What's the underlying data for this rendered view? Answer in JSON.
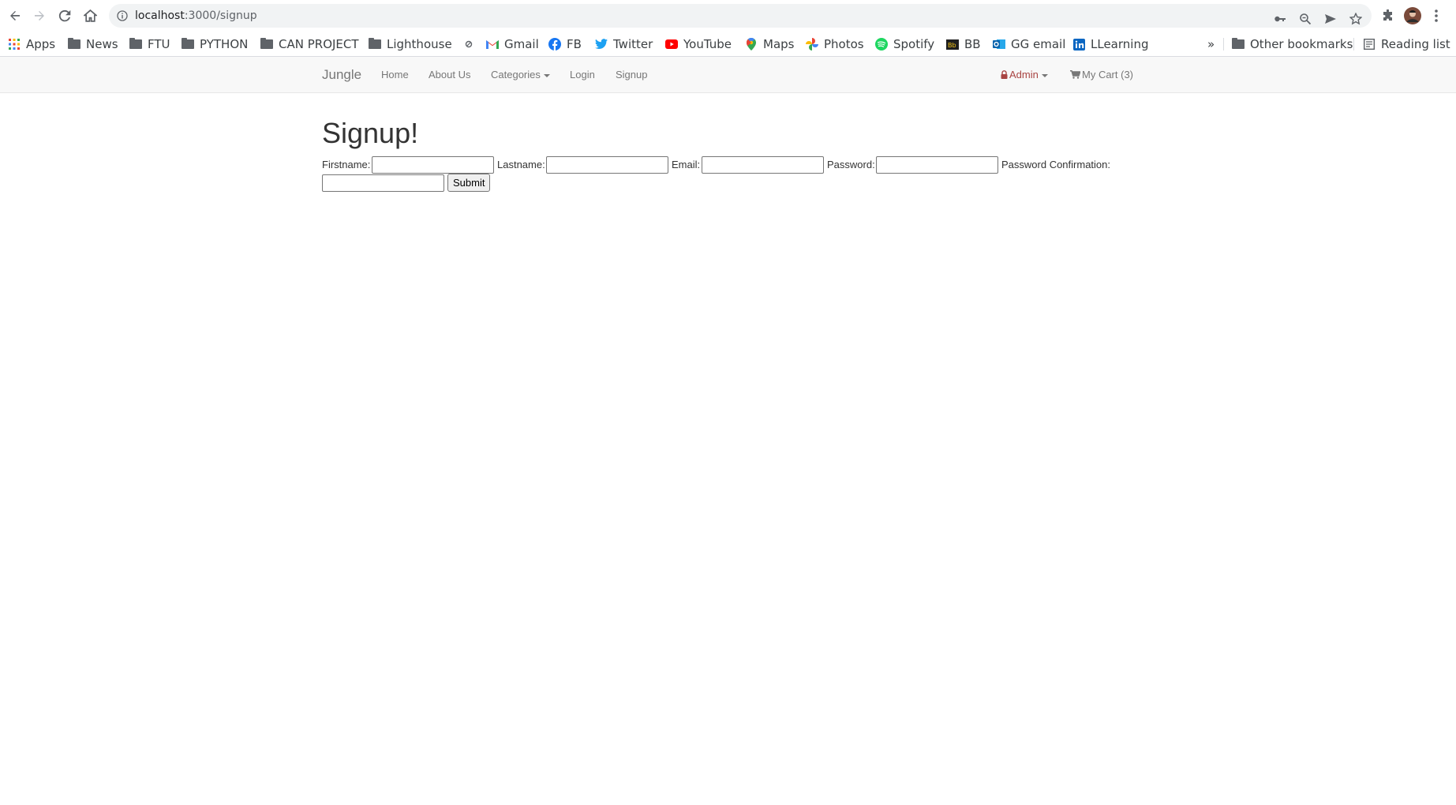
{
  "browser": {
    "url_host": "localhost",
    "url_path": ":3000/signup"
  },
  "bookmarks": [
    {
      "label": "Apps",
      "icon": "apps-grid-icon"
    },
    {
      "label": "News",
      "icon": "folder-icon"
    },
    {
      "label": "FTU",
      "icon": "folder-icon"
    },
    {
      "label": "PYTHON",
      "icon": "folder-icon"
    },
    {
      "label": "CAN PROJECT",
      "icon": "folder-icon"
    },
    {
      "label": "Lighthouse",
      "icon": "folder-icon"
    },
    {
      "label": "",
      "icon": "link-icon"
    },
    {
      "label": "Gmail",
      "icon": "gmail-icon"
    },
    {
      "label": "FB",
      "icon": "facebook-icon"
    },
    {
      "label": "Twitter",
      "icon": "twitter-icon"
    },
    {
      "label": "YouTube",
      "icon": "youtube-icon"
    },
    {
      "label": "Maps",
      "icon": "maps-icon"
    },
    {
      "label": "Photos",
      "icon": "photos-icon"
    },
    {
      "label": "Spotify",
      "icon": "spotify-icon"
    },
    {
      "label": "BB",
      "icon": "bb-icon"
    },
    {
      "label": "GG email",
      "icon": "outlook-icon"
    },
    {
      "label": "LLearning",
      "icon": "linkedin-icon"
    }
  ],
  "bookmarks_overflow": "»",
  "other_bookmarks": "Other bookmarks",
  "reading_list": "Reading list",
  "navbar": {
    "brand": "Jungle",
    "home": "Home",
    "about": "About Us",
    "categories": "Categories",
    "login": "Login",
    "signup": "Signup",
    "admin": "Admin",
    "cart": "My Cart (3)"
  },
  "page": {
    "title": "Signup!",
    "firstname_label": "Firstname:",
    "lastname_label": "Lastname:",
    "email_label": "Email:",
    "password_label": "Password:",
    "password_confirmation_label": "Password Confirmation:",
    "submit_label": "Submit"
  },
  "colors": {
    "admin": "#a94442",
    "navbar_bg": "#f8f8f8"
  }
}
